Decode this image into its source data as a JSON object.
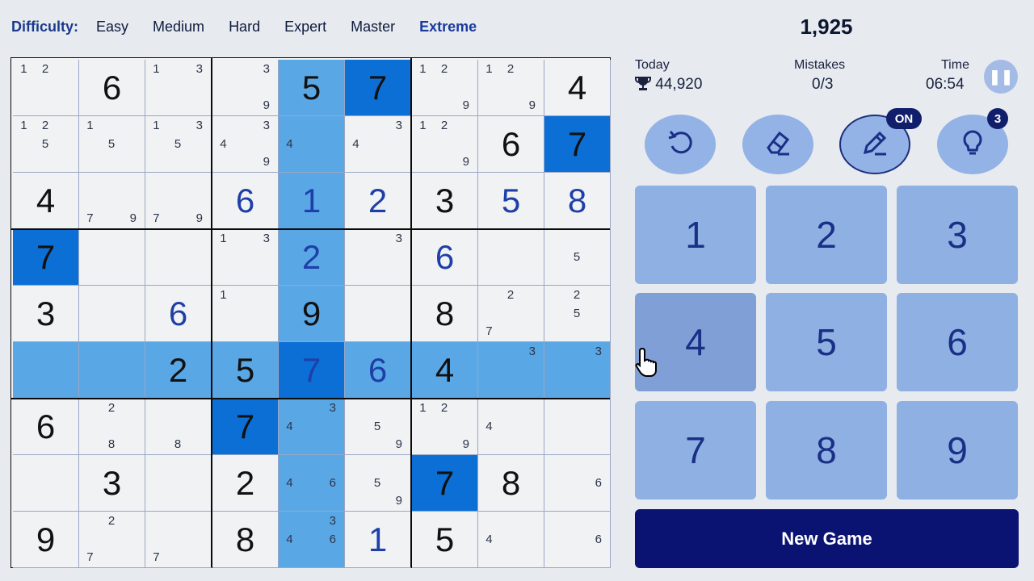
{
  "difficulty": {
    "label": "Difficulty:",
    "options": [
      "Easy",
      "Medium",
      "Hard",
      "Expert",
      "Master",
      "Extreme"
    ],
    "selected": "Extreme"
  },
  "score": "1,925",
  "stats": {
    "today_label": "Today",
    "today_value": "44,920",
    "mistakes_label": "Mistakes",
    "mistakes_value": "0/3",
    "time_label": "Time",
    "time_value": "06:54"
  },
  "tools": [
    {
      "name": "undo-button",
      "icon": "undo-icon",
      "badge": ""
    },
    {
      "name": "erase-button",
      "icon": "eraser-icon",
      "badge": ""
    },
    {
      "name": "notes-button",
      "icon": "pencil-icon",
      "badge": "ON"
    },
    {
      "name": "hint-button",
      "icon": "lightbulb-icon",
      "badge": "3"
    }
  ],
  "numpad": [
    "1",
    "2",
    "3",
    "4",
    "5",
    "6",
    "7",
    "8",
    "9"
  ],
  "new_game_label": "New Game",
  "colors": {
    "selected_cell": "#0b6fd6",
    "highlight": "#5aa7e6",
    "board_bg": "#f1f2f4",
    "user_digit": "#1f3fa8",
    "accent": "#0b1372"
  },
  "board": {
    "selected_cell": [
      5,
      4
    ],
    "cells": [
      [
        {
          "n": [
            "1",
            "2"
          ]
        },
        {
          "v": "6",
          "g": true
        },
        {
          "n": [
            "1",
            "3"
          ]
        },
        {
          "n": [
            "3",
            "9"
          ]
        },
        {
          "v": "5",
          "g": true
        },
        {
          "v": "7",
          "g": true
        },
        {
          "n": [
            "1",
            "2",
            "9"
          ]
        },
        {
          "n": [
            "1",
            "2",
            "9"
          ]
        },
        {
          "v": "4",
          "g": true
        }
      ],
      [
        {
          "n": [
            "1",
            "2",
            "5"
          ]
        },
        {
          "n": [
            "1",
            "5"
          ]
        },
        {
          "n": [
            "1",
            "3",
            "5"
          ]
        },
        {
          "n": [
            "3",
            "4",
            "9"
          ]
        },
        {
          "n": [
            "4"
          ]
        },
        {
          "n": [
            "3",
            "4"
          ]
        },
        {
          "n": [
            "1",
            "2",
            "9"
          ]
        },
        {
          "v": "6",
          "g": true
        },
        {
          "v": "7",
          "g": true
        }
      ],
      [
        {
          "v": "4",
          "g": true
        },
        {
          "n": [
            "7",
            "9"
          ]
        },
        {
          "n": [
            "7",
            "9"
          ]
        },
        {
          "v": "6",
          "g": false
        },
        {
          "v": "1",
          "g": false
        },
        {
          "v": "2",
          "g": false
        },
        {
          "v": "3",
          "g": true
        },
        {
          "v": "5",
          "g": false
        },
        {
          "v": "8",
          "g": false
        }
      ],
      [
        {
          "v": "7",
          "g": true
        },
        {},
        {},
        {
          "n": [
            "1",
            "3"
          ]
        },
        {
          "v": "2",
          "g": false
        },
        {
          "n": [
            "3"
          ]
        },
        {
          "v": "6",
          "g": false
        },
        {},
        {
          "n": [
            "5"
          ]
        }
      ],
      [
        {
          "v": "3",
          "g": true
        },
        {},
        {
          "v": "6",
          "g": false
        },
        {
          "n": [
            "1"
          ]
        },
        {
          "v": "9",
          "g": true
        },
        {},
        {
          "v": "8",
          "g": true
        },
        {
          "n": [
            "2",
            "7"
          ]
        },
        {
          "n": [
            "2",
            "5"
          ]
        }
      ],
      [
        {},
        {},
        {
          "v": "2",
          "g": true
        },
        {
          "v": "5",
          "g": true
        },
        {
          "v": "7",
          "g": false
        },
        {
          "v": "6",
          "g": false
        },
        {
          "v": "4",
          "g": true
        },
        {
          "n": [
            "3"
          ]
        },
        {
          "n": [
            "3"
          ]
        }
      ],
      [
        {
          "v": "6",
          "g": true
        },
        {
          "n": [
            "2",
            "8"
          ]
        },
        {
          "n": [
            "8"
          ]
        },
        {
          "v": "7",
          "g": true
        },
        {
          "n": [
            "3",
            "4"
          ]
        },
        {
          "n": [
            "5",
            "9"
          ]
        },
        {
          "n": [
            "1",
            "2",
            "9"
          ]
        },
        {
          "n": [
            "4"
          ]
        },
        {}
      ],
      [
        {},
        {
          "v": "3",
          "g": true
        },
        {},
        {
          "v": "2",
          "g": true
        },
        {
          "n": [
            "4",
            "6"
          ]
        },
        {
          "n": [
            "5",
            "9"
          ]
        },
        {
          "v": "7",
          "g": true
        },
        {
          "v": "8",
          "g": true
        },
        {
          "n": [
            "6"
          ]
        }
      ],
      [
        {
          "v": "9",
          "g": true
        },
        {
          "n": [
            "2",
            "7"
          ]
        },
        {
          "n": [
            "7"
          ]
        },
        {
          "v": "8",
          "g": true
        },
        {
          "n": [
            "3",
            "4",
            "6"
          ]
        },
        {
          "v": "1",
          "g": false
        },
        {
          "v": "5",
          "g": true
        },
        {
          "n": [
            "4"
          ]
        },
        {
          "n": [
            "6"
          ]
        }
      ]
    ]
  }
}
